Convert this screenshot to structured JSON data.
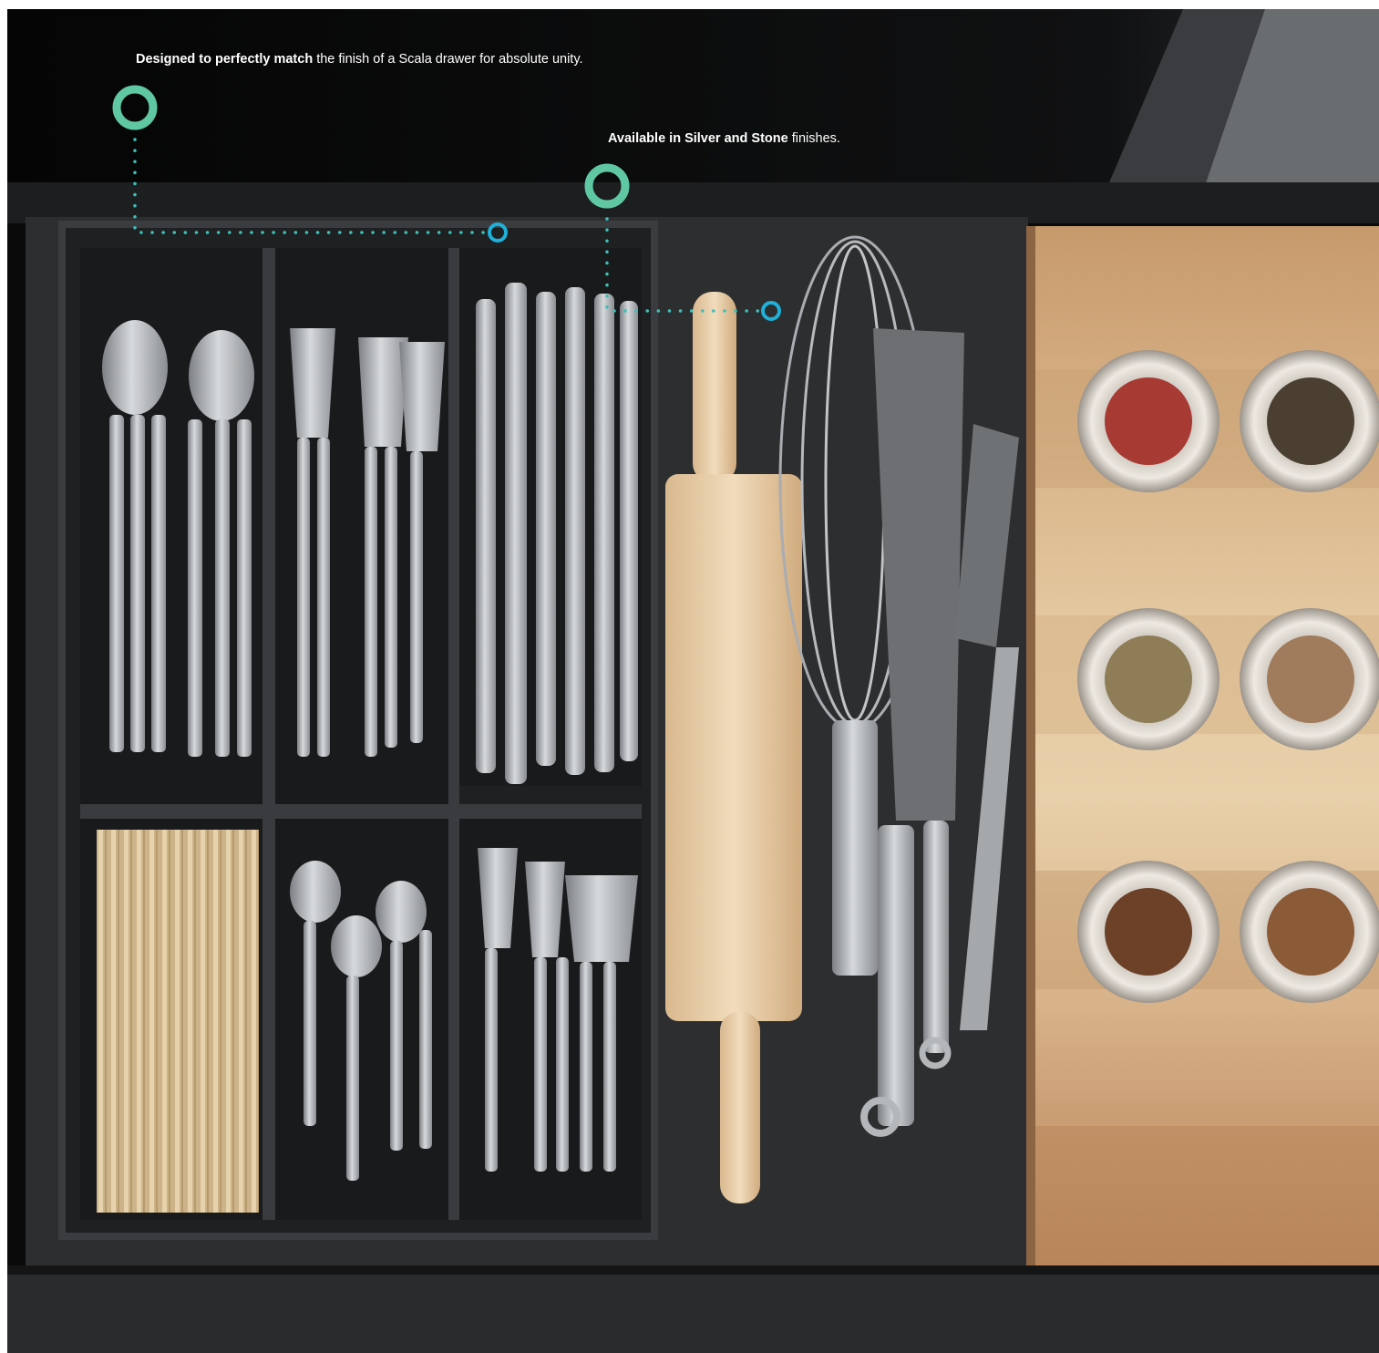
{
  "callouts": [
    {
      "bold": "Designed to perfectly match",
      "rest": " the finish of a Scala drawer for absolute unity."
    },
    {
      "bold": "Available in Silver and Stone",
      "rest": " finishes."
    }
  ],
  "colors": {
    "callout_ring": "#5fc7a2",
    "callout_target": "#1fb0d8",
    "callout_dots": "#3fbfb8",
    "drawer": "#2c2d2f",
    "background": "#0a0a0a",
    "wood": "#c89e72"
  }
}
